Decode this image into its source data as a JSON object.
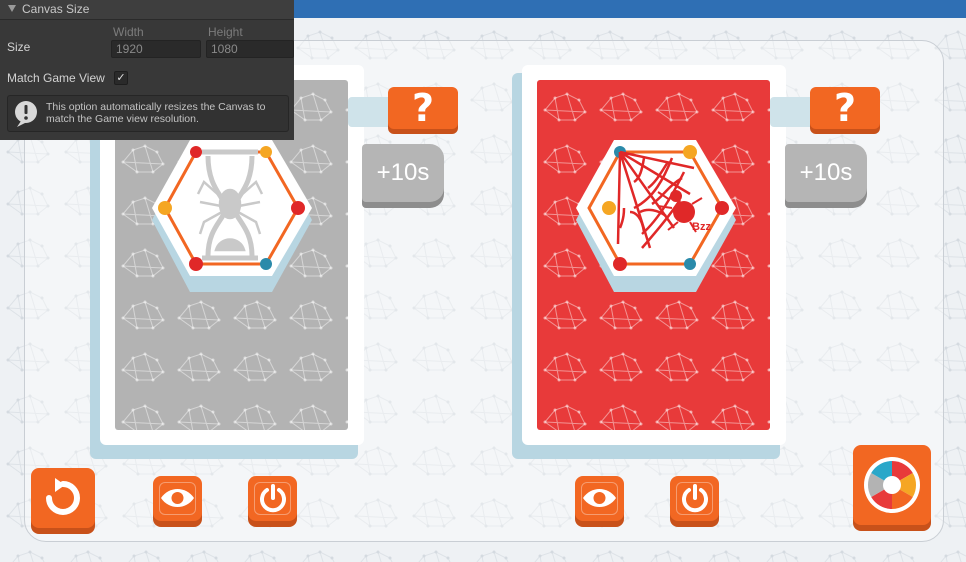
{
  "inspector": {
    "section_title": "Canvas Size",
    "size_label": "Size",
    "width_label": "Width",
    "height_label": "Height",
    "width_value": "1920",
    "height_value": "1080",
    "match_label": "Match Game View",
    "match_checked": "✓",
    "help_text": "This option automatically resizes the Canvas to match the Game view resolution."
  },
  "game": {
    "question_label": "?",
    "time_bonus_label": "+10s",
    "web_caption": "Bzz",
    "colors": {
      "orange": "#f26722",
      "red_card": "#e83a3a",
      "gray_card": "#b3b3b3",
      "card_shadow": "#b8d6e2",
      "background": "#eef1f4"
    },
    "icons": [
      "undo-icon",
      "eye-icon",
      "power-icon",
      "color-wheel-icon",
      "spider-hourglass-icon",
      "spider-web-icon"
    ]
  }
}
